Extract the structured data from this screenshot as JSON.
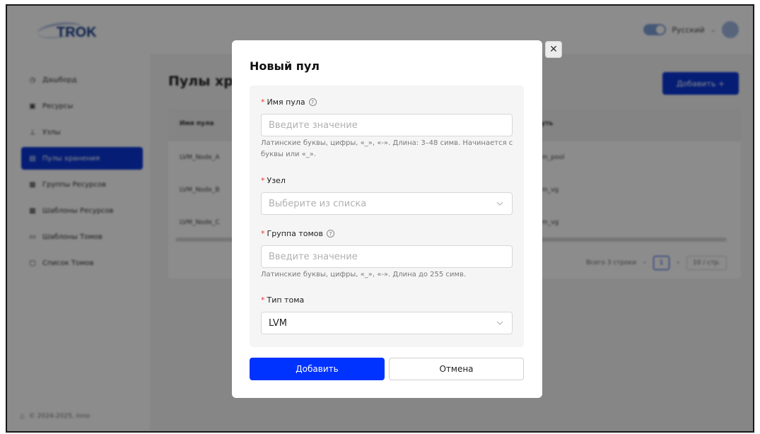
{
  "app": {
    "logo_text": "TROK",
    "language": "Русский",
    "sidebar": [
      {
        "label": "Дашборд",
        "icon": "dashboard-icon",
        "glyph": "◷"
      },
      {
        "label": "Ресурсы",
        "icon": "resources-icon",
        "glyph": "▣"
      },
      {
        "label": "Узлы",
        "icon": "nodes-icon",
        "glyph": "⊥"
      },
      {
        "label": "Пулы хранения",
        "icon": "storage-pool-icon",
        "glyph": "▤",
        "active": true
      },
      {
        "label": "Группы Ресурсов",
        "icon": "resource-groups-icon",
        "glyph": "▦"
      },
      {
        "label": "Шаблоны Ресурсов",
        "icon": "resource-templates-icon",
        "glyph": "▩"
      },
      {
        "label": "Шаблоны Томов",
        "icon": "volume-templates-icon",
        "glyph": "▭"
      },
      {
        "label": "Список Томов",
        "icon": "volume-list-icon",
        "glyph": "▢"
      }
    ],
    "copyright": "© 2024-2025, Inno",
    "page_title": "Пулы хранения",
    "add_button": "Добавить +",
    "table": {
      "headers": [
        "Имя пула",
        "Путь"
      ],
      "rows": [
        [
          "LVM_Node_A",
          "lvm_pool"
        ],
        [
          "LVM_Node_B",
          "lvm_vg"
        ],
        [
          "LVM_Node_C",
          "lvm_vg"
        ]
      ],
      "total": "Всего 3 строки",
      "page": "1",
      "page_size": "10 / стр."
    }
  },
  "modal": {
    "title": "Новый пул",
    "fields": {
      "pool_name": {
        "label": "Имя пула",
        "placeholder": "Введите значение",
        "help": "Латинские буквы, цифры, «_», «-». Длина: 3–48 симв. Начинается с буквы или «_»."
      },
      "node": {
        "label": "Узел",
        "placeholder": "Выберите из списка"
      },
      "volume_group": {
        "label": "Группа томов",
        "placeholder": "Введите значение",
        "help": "Латинские буквы, цифры, «_», «-». Длина до 255 симв."
      },
      "volume_type": {
        "label": "Тип тома",
        "value": "LVM"
      }
    },
    "submit": "Добавить",
    "cancel": "Отмена"
  },
  "colors": {
    "primary": "#0033ff",
    "sidebar_active": "#0a36d6",
    "required": "#e53935",
    "overlay": "rgba(0,0,0,0.45)"
  }
}
